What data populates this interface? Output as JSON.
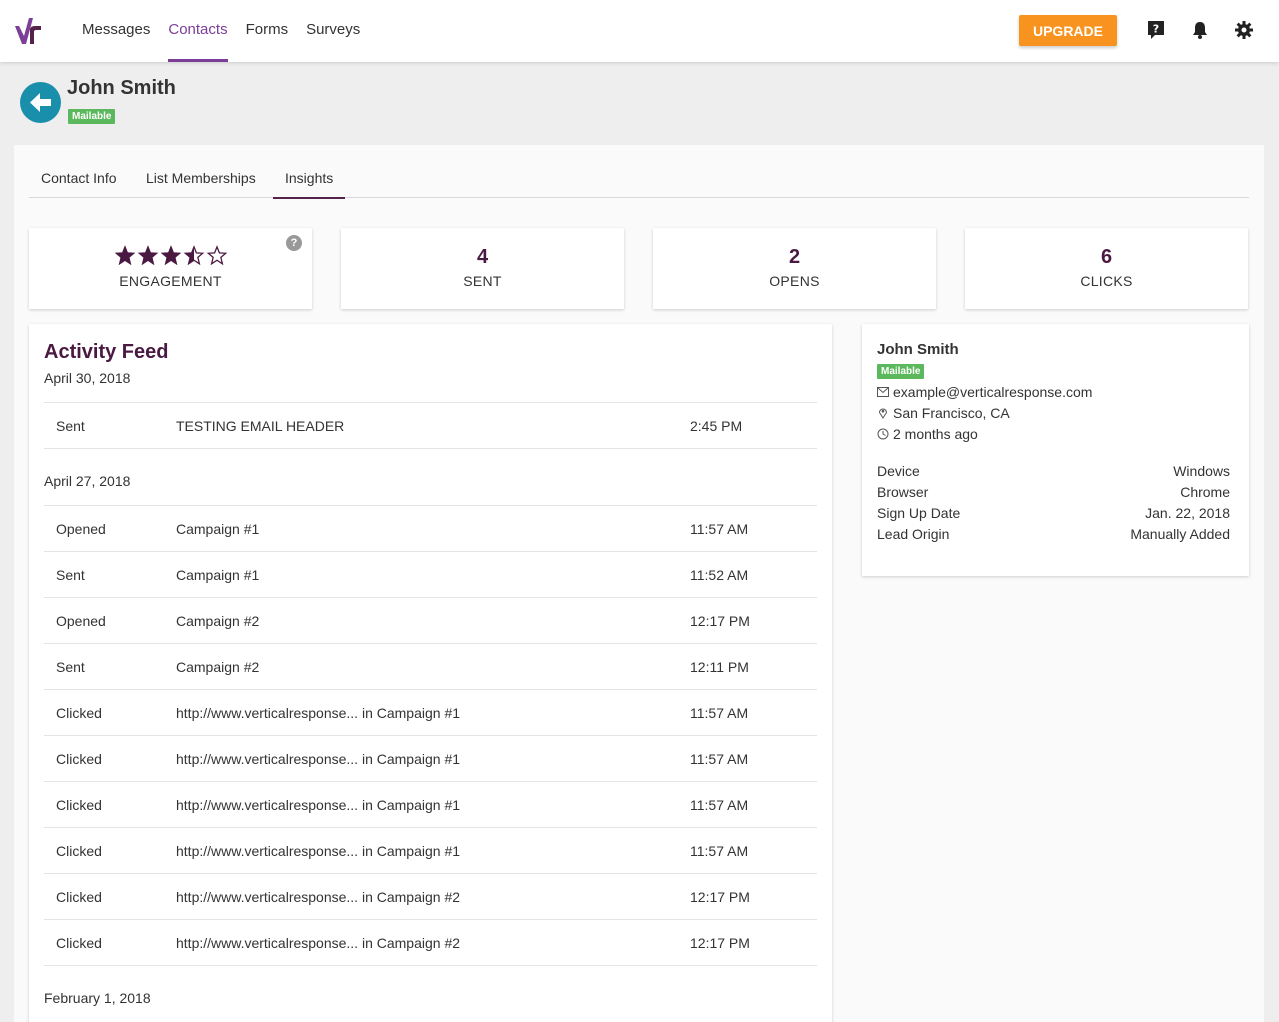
{
  "nav": {
    "items": [
      "Messages",
      "Contacts",
      "Forms",
      "Surveys"
    ],
    "active_index": 1,
    "upgrade_label": "UPGRADE"
  },
  "contact": {
    "name": "John Smith",
    "status": "Mailable"
  },
  "tabs": [
    "Contact Info",
    "List Memberships",
    "Insights"
  ],
  "active_tab": 2,
  "stats": {
    "engagement_rating": 3.5,
    "engagement_max": 5,
    "engagement_label": "ENGAGEMENT",
    "sent_value": "4",
    "sent_label": "SENT",
    "opens_value": "2",
    "opens_label": "OPENS",
    "clicks_value": "6",
    "clicks_label": "CLICKS"
  },
  "feed": {
    "title": "Activity Feed",
    "groups": [
      {
        "date": "April 30, 2018",
        "items": [
          {
            "type": "Sent",
            "desc": "TESTING EMAIL HEADER",
            "time": "2:45 PM"
          }
        ]
      },
      {
        "date": "April 27, 2018",
        "items": [
          {
            "type": "Opened",
            "desc": "Campaign #1",
            "time": "11:57 AM"
          },
          {
            "type": "Sent",
            "desc": "Campaign #1",
            "time": "11:52 AM"
          },
          {
            "type": "Opened",
            "desc": "Campaign #2",
            "time": "12:17 PM"
          },
          {
            "type": "Sent",
            "desc": "Campaign #2",
            "time": "12:11 PM"
          },
          {
            "type": "Clicked",
            "desc": "http://www.verticalresponse... in Campaign #1",
            "time": "11:57 AM"
          },
          {
            "type": "Clicked",
            "desc": "http://www.verticalresponse... in Campaign #1",
            "time": "11:57 AM"
          },
          {
            "type": "Clicked",
            "desc": "http://www.verticalresponse... in Campaign #1",
            "time": "11:57 AM"
          },
          {
            "type": "Clicked",
            "desc": "http://www.verticalresponse... in Campaign #1",
            "time": "11:57 AM"
          },
          {
            "type": "Clicked",
            "desc": "http://www.verticalresponse... in Campaign #2",
            "time": "12:17 PM"
          },
          {
            "type": "Clicked",
            "desc": "http://www.verticalresponse... in Campaign #2",
            "time": "12:17 PM"
          }
        ]
      },
      {
        "date": "February 1, 2018",
        "items": []
      }
    ]
  },
  "summary": {
    "name": "John Smith",
    "status": "Mailable",
    "email": "example@verticalresponse.com",
    "location": "San Francisco, CA",
    "last_activity": "2 months ago",
    "details": [
      {
        "key": "Device",
        "value": "Windows"
      },
      {
        "key": "Browser",
        "value": "Chrome"
      },
      {
        "key": "Sign Up Date",
        "value": "Jan. 22, 2018"
      },
      {
        "key": "Lead Origin",
        "value": "Manually Added"
      }
    ]
  },
  "colors": {
    "brand_purple": "#7b3f97",
    "dark_plum": "#4a1942",
    "upgrade_orange": "#f7931e",
    "mailable_green": "#5cb85c",
    "back_teal": "#1a8fab"
  },
  "icons": {
    "logo": "vr-logo",
    "help": "help-question-icon",
    "notifications": "bell-icon",
    "settings": "gear-icon",
    "back": "arrow-left-icon",
    "email": "envelope-icon",
    "location": "map-pin-icon",
    "time": "clock-icon",
    "engagement_help": "question-circle-icon"
  }
}
